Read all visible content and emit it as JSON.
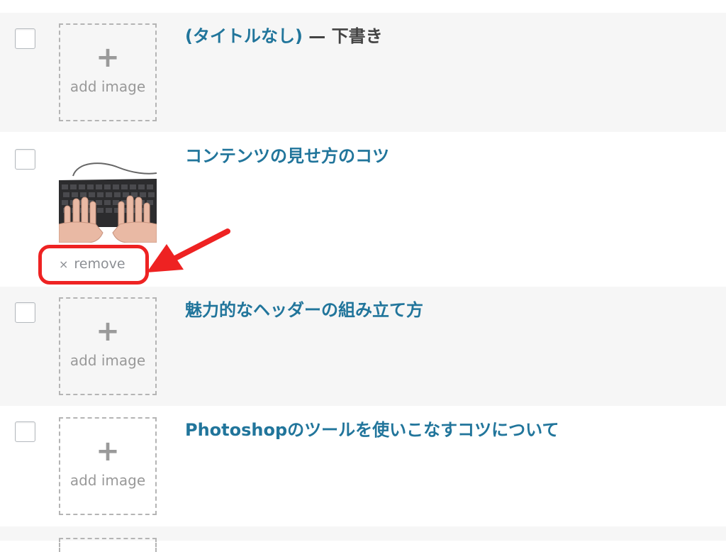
{
  "posts": [
    {
      "title": "(タイトルなし)",
      "separator": " — ",
      "state": "下書き",
      "image_action_icon": "plus-icon",
      "image_action_label": "add image"
    },
    {
      "title": "コンテンツの見せ方のコツ",
      "featured_image": "keyboard-typing-photo",
      "remove_icon": "×",
      "remove_label": "remove"
    },
    {
      "title": "魅力的なヘッダーの組み立て方",
      "image_action_icon": "plus-icon",
      "image_action_label": "add image"
    },
    {
      "title": "Photoshopのツールを使いこなすコツについて",
      "image_action_icon": "plus-icon",
      "image_action_label": "add image"
    }
  ],
  "colors": {
    "title_link": "#21759b",
    "state_text": "#444444",
    "row_alt_bg": "#f6f6f6",
    "annotation_red": "#ee2222",
    "placeholder_text": "#999999"
  }
}
